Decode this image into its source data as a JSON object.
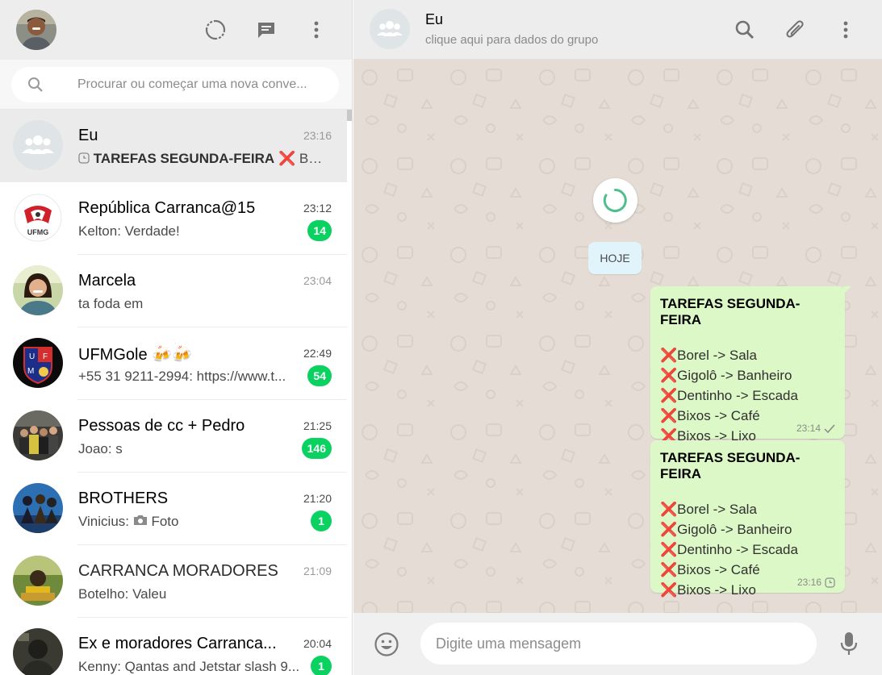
{
  "sidebar": {
    "search": {
      "placeholder": "Procurar ou começar uma nova conve..."
    },
    "chats": [
      {
        "name": "Eu",
        "time": "23:16",
        "preview_title": "TAREFAS SEGUNDA-FEIRA",
        "preview_rest": " Bor...",
        "unread": null,
        "active": true
      },
      {
        "name": "República Carranca@15",
        "time": "23:12",
        "preview": "Kelton: Verdade!",
        "unread": "14"
      },
      {
        "name": "Marcela",
        "time": "23:04",
        "preview": "ta foda em",
        "unread": null
      },
      {
        "name": "UFMGole 🍻🍻",
        "time": "22:49",
        "preview": "+55 31 9211-2994: https://www.t...",
        "unread": "54"
      },
      {
        "name": "Pessoas de cc + Pedro",
        "time": "21:25",
        "preview": "Joao: s",
        "unread": "146"
      },
      {
        "name": "BROTHERS",
        "time": "21:20",
        "preview_prefix": "Vinicius: ",
        "preview": "Foto",
        "unread": "1"
      },
      {
        "name": "CARRANCA MORADORES",
        "time": "21:09",
        "preview": "Botelho: Valeu",
        "unread": null
      },
      {
        "name": "Ex e moradores Carranca...",
        "time": "20:04",
        "preview": "Kenny: Qantas and Jetstar slash 9...",
        "unread": "1"
      }
    ]
  },
  "conversation": {
    "title": "Eu",
    "subtitle": "clique aqui para dados do grupo",
    "date_chip": "HOJE",
    "messages": [
      {
        "title": "TAREFAS SEGUNDA-FEIRA",
        "lines": [
          "Borel -> Sala",
          "Gigolô -> Banheiro",
          "Dentinho -> Escada",
          "Bixos -> Café",
          "Bixos -> Lixo"
        ],
        "time": "23:14",
        "status": "sent"
      },
      {
        "title": "TAREFAS SEGUNDA-FEIRA",
        "lines": [
          "Borel -> Sala",
          "Gigolô -> Banheiro",
          "Dentinho -> Escada",
          "Bixos -> Café",
          "Bixos -> Lixo"
        ],
        "time": "23:16",
        "status": "pending"
      }
    ],
    "x_mark": "❌"
  },
  "compose": {
    "placeholder": "Digite uma mensagem"
  },
  "colors": {
    "accent_green": "#09d261",
    "outgoing_bubble": "#dcf8c6",
    "chat_background": "#e5ddd5",
    "header_bg": "#ededed"
  }
}
